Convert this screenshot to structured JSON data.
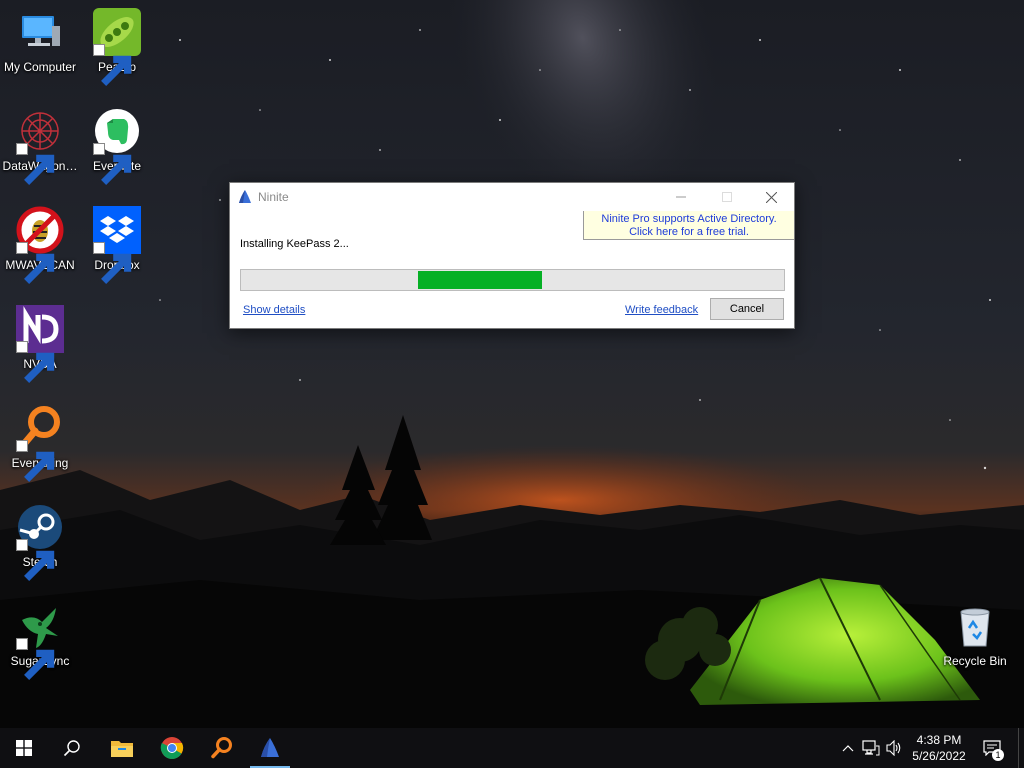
{
  "desktop": {
    "icons": [
      {
        "label": "My Computer",
        "icon": "computer-icon",
        "shortcut": false
      },
      {
        "label": "PeaZip",
        "icon": "peazip-icon",
        "shortcut": true
      },
      {
        "label": "DataWagon…",
        "icon": "datawagon-icon",
        "shortcut": true
      },
      {
        "label": "Evernote",
        "icon": "evernote-icon",
        "shortcut": true
      },
      {
        "label": "MWAVSCAN",
        "icon": "mwavscan-icon",
        "shortcut": true
      },
      {
        "label": "Dropbox",
        "icon": "dropbox-icon",
        "shortcut": true
      },
      {
        "label": "NVDA",
        "icon": "nvda-icon",
        "shortcut": true
      },
      {
        "label": "Everything",
        "icon": "everything-icon",
        "shortcut": true
      },
      {
        "label": "Steam",
        "icon": "steam-icon",
        "shortcut": true
      },
      {
        "label": "SugarSync",
        "icon": "sugarsync-icon",
        "shortcut": true
      },
      {
        "label": "Recycle Bin",
        "icon": "recycle-bin-icon",
        "shortcut": false
      }
    ]
  },
  "window": {
    "title": "Ninite",
    "promo_line1": "Ninite Pro supports Active Directory.",
    "promo_line2": "Click here for a free trial.",
    "status": "Installing KeePass 2...",
    "progress_fraction": 0.23,
    "show_details": "Show details",
    "write_feedback": "Write feedback",
    "cancel": "Cancel"
  },
  "taskbar": {
    "pinned": [
      "start-icon",
      "search-icon",
      "file-explorer-icon",
      "chrome-icon",
      "everything-icon",
      "ninite-icon"
    ],
    "active": "ninite-icon",
    "clock_time": "4:38 PM",
    "clock_date": "5/26/2022",
    "notification_count": "1"
  },
  "colors": {
    "progress_green": "#06b025",
    "link_blue": "#1f4ec4",
    "promo_bg": "#ffffe1"
  }
}
